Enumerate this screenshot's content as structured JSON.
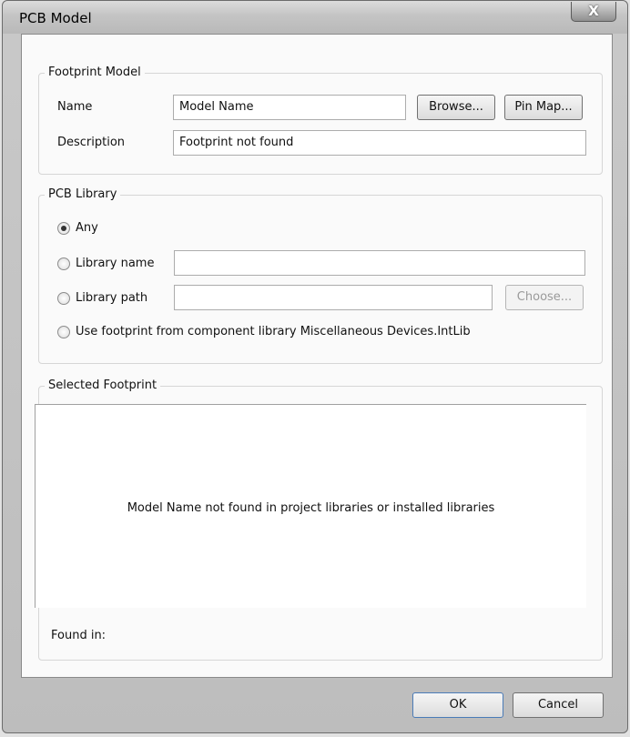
{
  "window": {
    "title": "PCB Model",
    "close_label": "X"
  },
  "footprint_model": {
    "legend": "Footprint Model",
    "name_label": "Name",
    "name_value": "Model Name",
    "browse_label": "Browse...",
    "pin_map_label": "Pin Map...",
    "description_label": "Description",
    "description_value": "Footprint not found"
  },
  "pcb_library": {
    "legend": "PCB Library",
    "any_label": "Any",
    "library_name_label": "Library name",
    "library_name_value": "",
    "library_path_label": "Library path",
    "library_path_value": "",
    "choose_label": "Choose...",
    "use_footprint_label": "Use footprint from component library Miscellaneous Devices.IntLib",
    "selected_option": "Any"
  },
  "selected_footprint": {
    "legend": "Selected Footprint",
    "message": "Model Name not found in project libraries or installed libraries",
    "found_in_label": "Found in:"
  },
  "footer": {
    "ok_label": "OK",
    "cancel_label": "Cancel"
  }
}
